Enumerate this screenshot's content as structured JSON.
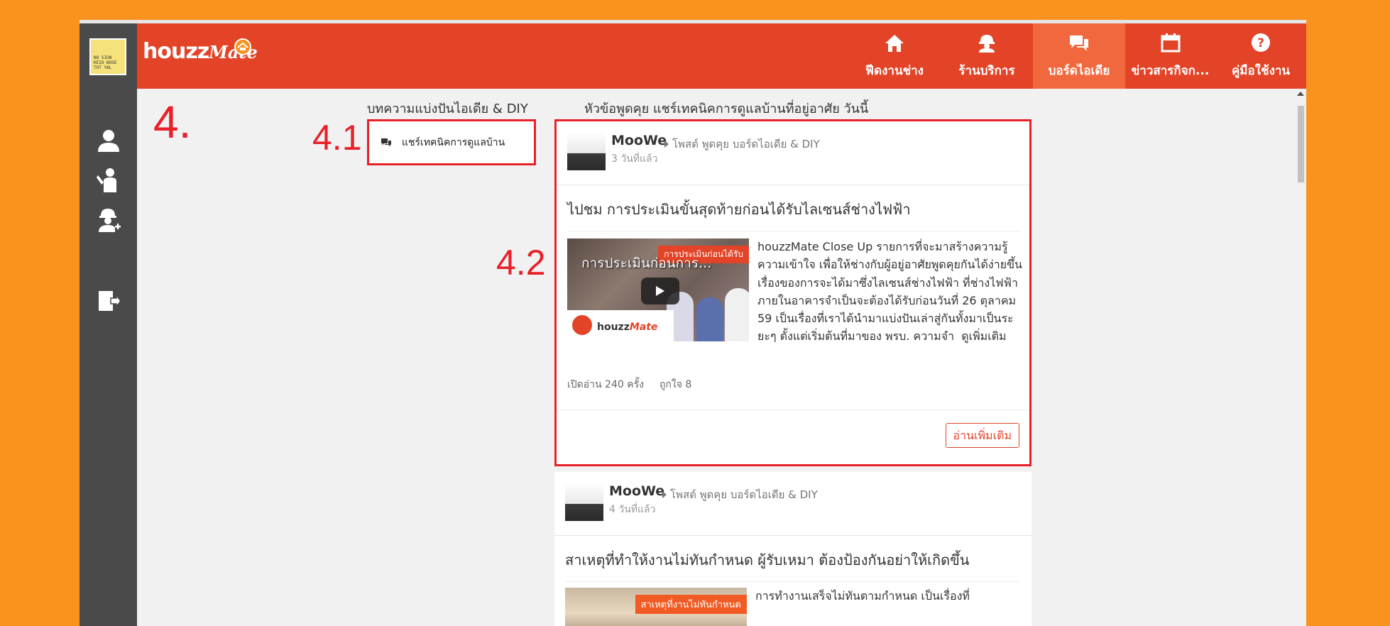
{
  "header": {
    "logo_houzz": "houzz",
    "logo_mate": "Mate",
    "nav": [
      {
        "label": "ฟีดงานช่าง",
        "icon": "home-icon",
        "active": false
      },
      {
        "label": "ร้านบริการ",
        "icon": "worker-icon",
        "active": false
      },
      {
        "label": "บอร์ดไอเดีย",
        "icon": "chat-icon",
        "active": true
      },
      {
        "label": "ข่าวสารกิจก...",
        "icon": "calendar-icon",
        "active": false
      },
      {
        "label": "คู่มือใช้งาน",
        "icon": "help-icon",
        "active": false
      }
    ]
  },
  "sidebar": {
    "avatar_text": "NO SIGN KEIO BOSE TUT YAL",
    "icons": [
      "user-icon",
      "technician-icon",
      "add-worker-icon",
      "logout-icon"
    ]
  },
  "annotations": {
    "step": "4.",
    "step_1": "4.1",
    "step_2": "4.2"
  },
  "columns": {
    "left_title": "บทความแบ่งปันไอเดีย & DIY",
    "right_title": "หัวข้อพูดคุย แชร์เทคนิคการดูแลบ้านที่อยู่อาศัย วันนี้"
  },
  "category": {
    "label": "แชร์เทคนิคการดูแลบ้าน"
  },
  "posts": [
    {
      "author": "MooWe",
      "meta": "โพสต์ พูดคุย บอร์ดไอเดีย & DIY",
      "time": "3 วันที่แล้ว",
      "title": "ไปชม การประเมินขั้นสุดท้ายก่อนได้รับไลเซนส์ช่างไฟฟ้า",
      "thumb_title": "การประเมินก่อนการ...",
      "thumb_tag": "การประเมินก่อนได้รับ",
      "thumb_brand": "houzz",
      "thumb_brand_mate": "Mate",
      "excerpt": "houzzMate Close Up รายการที่จะมาสร้างความรู้ความเข้าใจ เพื่อให้ช่างกับผู้อยู่อาศัยพูดคุยกันได้ง่ายขึ้น เรื่องของการจะได้มาซึ่งไลเซนส์ช่างไฟฟ้า ที่ช่างไฟฟ้าภายในอาคารจำเป็นจะต้องได้รับก่อนวันที่ 26 ตุลาคม 59 เป็นเรื่องที่เราได้นำมาแบ่งปันเล่าสู่กันทั้งมาเป็นระยะๆ ตั้งแต่เริ่มต้นที่มาของ พรบ. ความจำ",
      "see_more": "ดูเพิ่มเติม",
      "views": "เปิดอ่าน 240 ครั้ง",
      "likes": "ถูกใจ 8",
      "read_more": "อ่านเพิ่มเติม"
    },
    {
      "author": "MooWe",
      "meta": "โพสต์ พูดคุย บอร์ดไอเดีย & DIY",
      "time": "4 วันที่แล้ว",
      "title": "สาเหตุที่ทำให้งานไม่ทันกำหนด ผู้รับเหมา ต้องป้องกันอย่าให้เกิดขึ้น",
      "thumb_tag": "สาเหตุที่งานไม่ทันกำหนด",
      "excerpt": "การทำงานเสร็จไม่ทันตามกำหนด เป็นเรื่องที่"
    }
  ],
  "colors": {
    "brand": "#E34428",
    "active_nav": "#F2683E",
    "background": "#F7931E",
    "highlight": "#E8202A"
  }
}
